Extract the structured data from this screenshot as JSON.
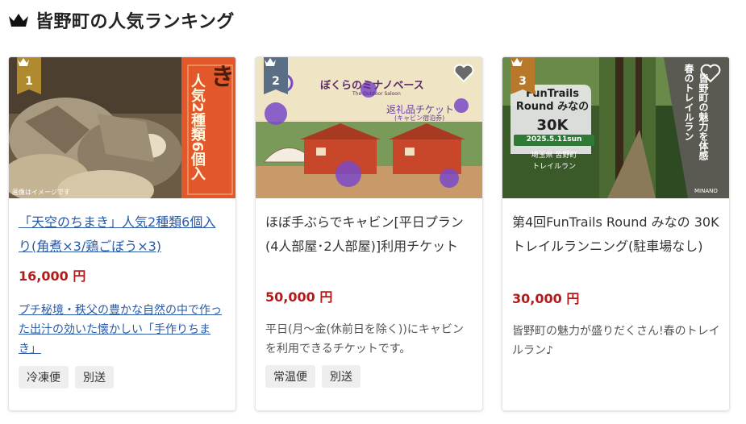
{
  "header": {
    "title": "皆野町の人気ランキング"
  },
  "cards": [
    {
      "rank": "1",
      "title": "「天空のちまき」人気2種類6個入り(角煮×3/鶏ごぼう×3)",
      "price": "16,000 円",
      "description": "プチ秘境・秩父の豊かな自然の中で作った出汁の効いた懐かしい「手作りちまき」",
      "tags": [
        "冷凍便",
        "別送"
      ],
      "image_text": {
        "main": "天空のちまき",
        "sub": "人気2種類6個入",
        "credit": "画像はイメージです"
      },
      "rank_color": "#b08a2e"
    },
    {
      "rank": "2",
      "title": "ほぼ手ぶらでキャビン[平日プラン(4人部屋･2人部屋)]利用チケット",
      "price": "50,000 円",
      "description": "平日(月～金(休前日を除く))にキャビンを利用できるチケットです。",
      "tags": [
        "常温便",
        "別送"
      ],
      "image_text": {
        "brand": "ぼくらのミナノベース",
        "brand_sub": "The Outdoor Saloon",
        "ticket": "返礼品チケット",
        "ticket_sub": "(キャビン宿泊券)"
      },
      "rank_color": "#5a6e86"
    },
    {
      "rank": "3",
      "title": "第4回FunTrails Round みなの 30K トレイルランニング(駐車場なし)",
      "price": "30,000 円",
      "description": "皆野町の魅力が盛りだくさん!春のトレイルラン♪",
      "tags": [],
      "image_text": {
        "event": "FunTrails Round みなの",
        "distance": "30K",
        "date": "2025.5.11sun",
        "place": "埼玉県 皆野町",
        "kind": "トレイルラン",
        "vertical1": "皆野町の魅力を体感",
        "vertical2": "春のトレイルラン",
        "logo": "MINANO"
      },
      "rank_color": "#b8782a"
    }
  ],
  "colors": {
    "price": "#b31b1b",
    "link": "#2a5aa8",
    "tag_bg": "#eeeeee"
  },
  "icons": {
    "header": "crown-icon",
    "favorite": "heart-icon"
  }
}
